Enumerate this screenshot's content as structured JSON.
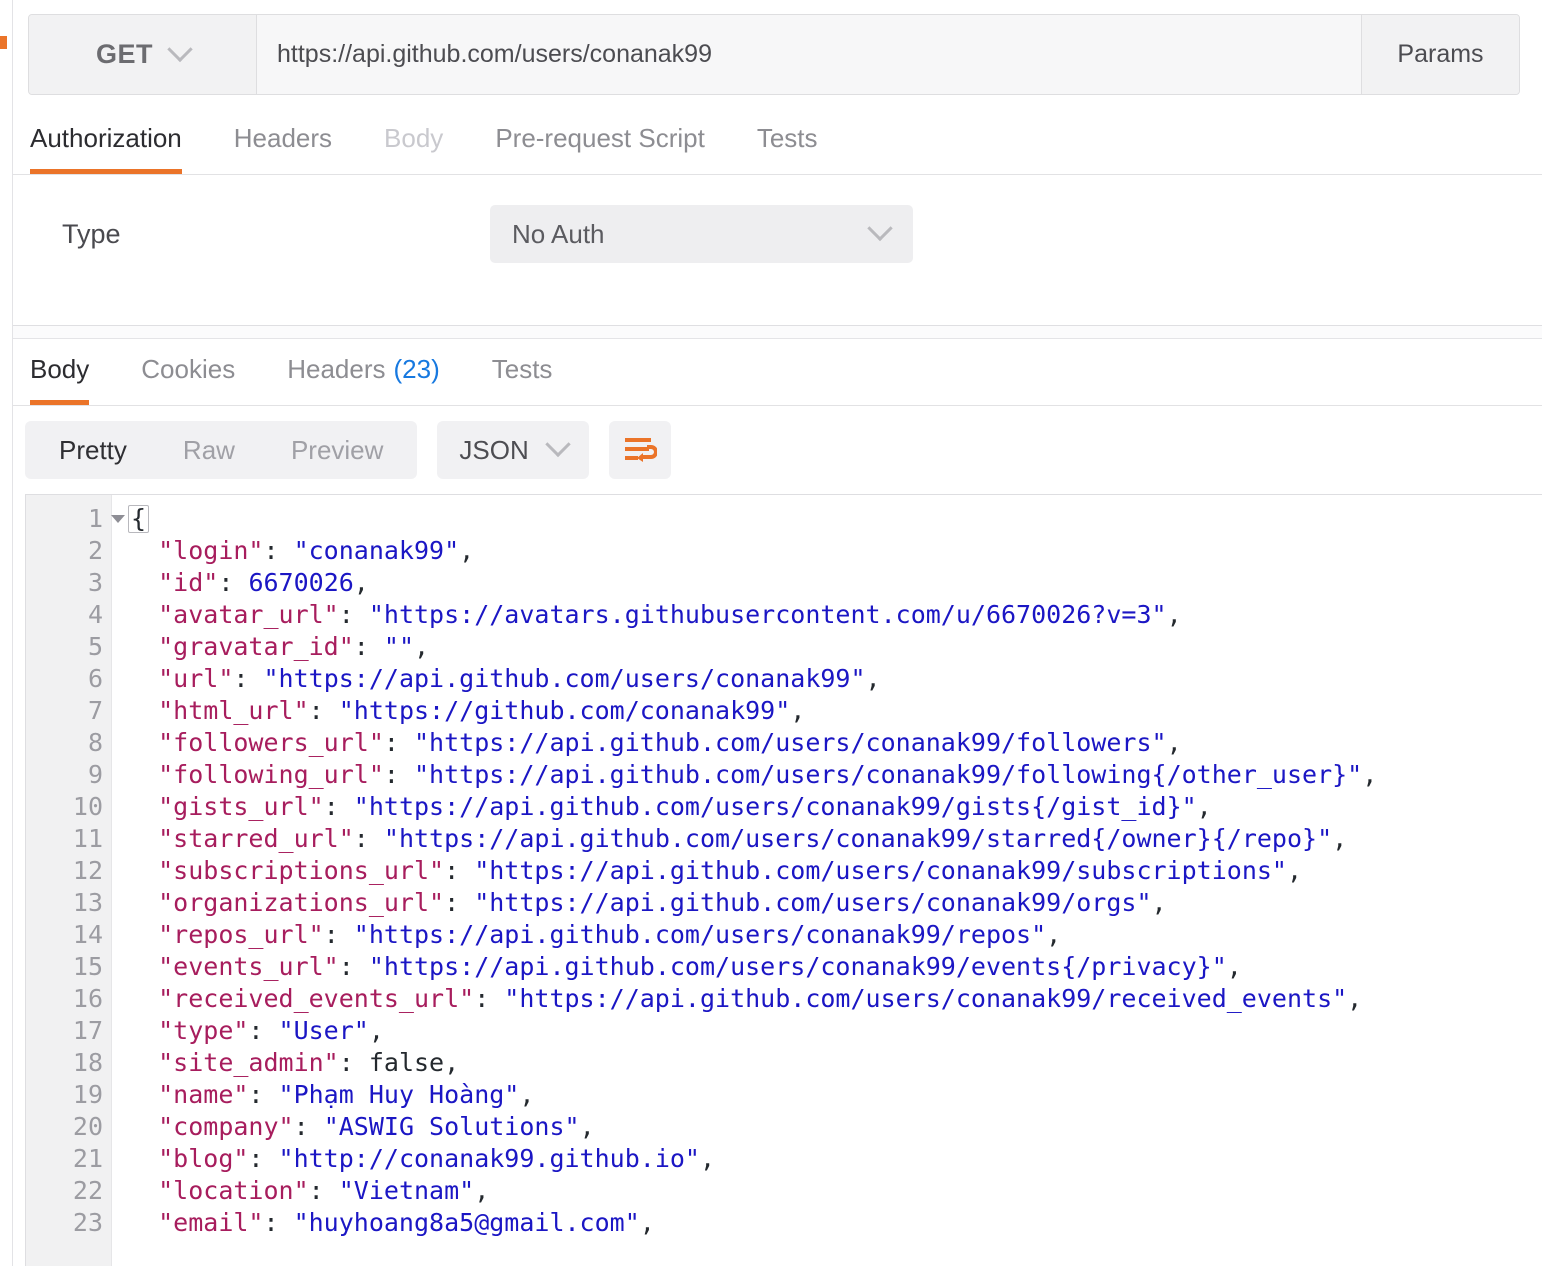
{
  "request": {
    "method": "GET",
    "url": "https://api.github.com/users/conanak99",
    "params_label": "Params",
    "tabs": [
      {
        "label": "Authorization",
        "state": "active"
      },
      {
        "label": "Headers",
        "state": "normal"
      },
      {
        "label": "Body",
        "state": "disabled"
      },
      {
        "label": "Pre-request Script",
        "state": "normal"
      },
      {
        "label": "Tests",
        "state": "normal"
      }
    ]
  },
  "authorization": {
    "type_label": "Type",
    "type_value": "No Auth"
  },
  "response": {
    "tabs": [
      {
        "label": "Body",
        "state": "active",
        "count": ""
      },
      {
        "label": "Cookies",
        "state": "normal",
        "count": ""
      },
      {
        "label": "Headers",
        "state": "normal",
        "count": "(23)"
      },
      {
        "label": "Tests",
        "state": "normal",
        "count": ""
      }
    ],
    "view_modes": [
      {
        "label": "Pretty",
        "state": "active"
      },
      {
        "label": "Raw",
        "state": "normal"
      },
      {
        "label": "Preview",
        "state": "normal"
      }
    ],
    "format": "JSON",
    "wrap_icon": "word-wrap-icon"
  },
  "colors": {
    "accent": "#eb7429",
    "link_blue": "#1779e0",
    "json_key": "#a71d5d",
    "json_string": "#1b16c4",
    "json_literal": "#24292e"
  },
  "body_json": {
    "lines": [
      {
        "n": 1,
        "type": "open",
        "text": "{"
      },
      {
        "n": 2,
        "type": "string",
        "key": "login",
        "value": "conanak99"
      },
      {
        "n": 3,
        "type": "number",
        "key": "id",
        "value": "6670026"
      },
      {
        "n": 4,
        "type": "string",
        "key": "avatar_url",
        "value": "https://avatars.githubusercontent.com/u/6670026?v=3"
      },
      {
        "n": 5,
        "type": "string",
        "key": "gravatar_id",
        "value": ""
      },
      {
        "n": 6,
        "type": "string",
        "key": "url",
        "value": "https://api.github.com/users/conanak99"
      },
      {
        "n": 7,
        "type": "string",
        "key": "html_url",
        "value": "https://github.com/conanak99"
      },
      {
        "n": 8,
        "type": "string",
        "key": "followers_url",
        "value": "https://api.github.com/users/conanak99/followers"
      },
      {
        "n": 9,
        "type": "string",
        "key": "following_url",
        "value": "https://api.github.com/users/conanak99/following{/other_user}"
      },
      {
        "n": 10,
        "type": "string",
        "key": "gists_url",
        "value": "https://api.github.com/users/conanak99/gists{/gist_id}"
      },
      {
        "n": 11,
        "type": "string",
        "key": "starred_url",
        "value": "https://api.github.com/users/conanak99/starred{/owner}{/repo}"
      },
      {
        "n": 12,
        "type": "string",
        "key": "subscriptions_url",
        "value": "https://api.github.com/users/conanak99/subscriptions"
      },
      {
        "n": 13,
        "type": "string",
        "key": "organizations_url",
        "value": "https://api.github.com/users/conanak99/orgs"
      },
      {
        "n": 14,
        "type": "string",
        "key": "repos_url",
        "value": "https://api.github.com/users/conanak99/repos"
      },
      {
        "n": 15,
        "type": "string",
        "key": "events_url",
        "value": "https://api.github.com/users/conanak99/events{/privacy}"
      },
      {
        "n": 16,
        "type": "string",
        "key": "received_events_url",
        "value": "https://api.github.com/users/conanak99/received_events"
      },
      {
        "n": 17,
        "type": "string",
        "key": "type",
        "value": "User"
      },
      {
        "n": 18,
        "type": "literal",
        "key": "site_admin",
        "value": "false"
      },
      {
        "n": 19,
        "type": "string",
        "key": "name",
        "value": "Phạm Huy Hoàng"
      },
      {
        "n": 20,
        "type": "string",
        "key": "company",
        "value": "ASWIG Solutions"
      },
      {
        "n": 21,
        "type": "string",
        "key": "blog",
        "value": "http://conanak99.github.io"
      },
      {
        "n": 22,
        "type": "string",
        "key": "location",
        "value": "Vietnam"
      },
      {
        "n": 23,
        "type": "string",
        "key": "email",
        "value": "huyhoang8a5@gmail.com"
      }
    ]
  }
}
